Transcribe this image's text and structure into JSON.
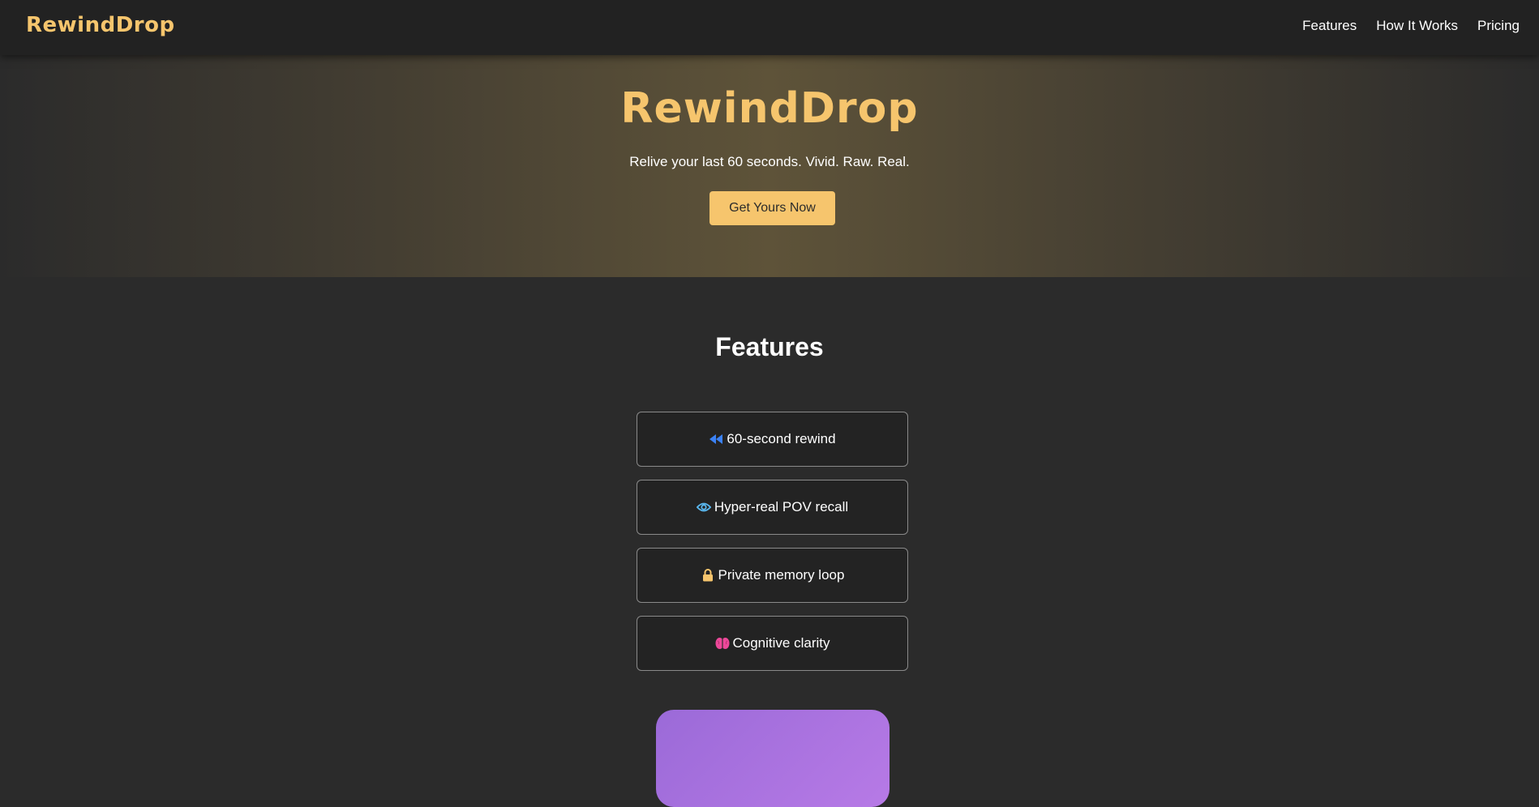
{
  "nav": {
    "brand": "RewindDrop",
    "links": [
      "Features",
      "How It Works",
      "Pricing"
    ]
  },
  "hero": {
    "title": "RewindDrop",
    "tagline": "Relive your last 60 seconds. Vivid. Raw. Real.",
    "cta_label": "Get Yours Now"
  },
  "features": {
    "title": "Features",
    "items": [
      {
        "icon": "rewind-icon",
        "label": "60-second rewind"
      },
      {
        "icon": "eye-icon",
        "label": "Hyper-real POV recall"
      },
      {
        "icon": "lock-icon",
        "label": "Private memory loop"
      },
      {
        "icon": "brain-icon",
        "label": "Cognitive clarity"
      }
    ]
  },
  "colors": {
    "accent": "#f6c56d",
    "background": "#2b2b2b",
    "navbar": "#222222",
    "rewind_icon": "#3b82f6",
    "eye_icon": "#5ab8f0",
    "lock_icon": "#f6c56d",
    "brain_icon": "#ec4899",
    "promo_gradient_start": "#9b6ad8",
    "promo_gradient_end": "#b77ae6"
  }
}
